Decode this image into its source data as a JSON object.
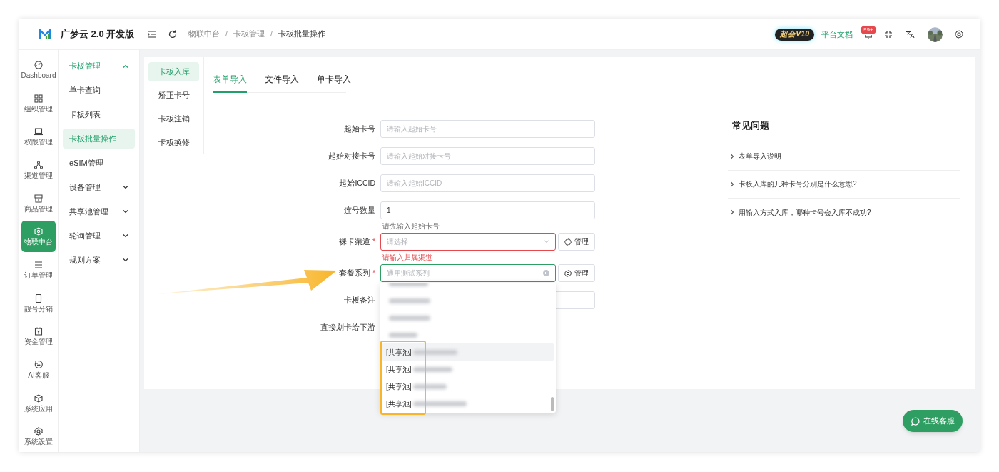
{
  "app": {
    "title": "广梦云 2.0 开发版"
  },
  "breadcrumb": [
    "物联中台",
    "卡板管理",
    "卡板批量操作"
  ],
  "breadcrumb_separator": "/",
  "header": {
    "badge": "超会V10",
    "docs_link": "平台文档",
    "notifications": "99+"
  },
  "rail": [
    {
      "label": "Dashboard",
      "selected": false
    },
    {
      "label": "组织管理",
      "selected": false
    },
    {
      "label": "权限管理",
      "selected": false
    },
    {
      "label": "渠道管理",
      "selected": false
    },
    {
      "label": "商品管理",
      "selected": false
    },
    {
      "label": "物联中台",
      "selected": true
    },
    {
      "label": "订单管理",
      "selected": false
    },
    {
      "label": "靓号分销",
      "selected": false
    },
    {
      "label": "资金管理",
      "selected": false
    },
    {
      "label": "AI客服",
      "selected": false
    },
    {
      "label": "系统应用",
      "selected": false
    },
    {
      "label": "系统设置",
      "selected": false
    }
  ],
  "sidebar": {
    "items": [
      {
        "label": "卡板管理",
        "expanded": true,
        "children": [
          {
            "label": "单卡查询",
            "selected": false
          },
          {
            "label": "卡板列表",
            "selected": false
          },
          {
            "label": "卡板批量操作",
            "selected": true
          }
        ]
      },
      {
        "label": "eSIM管理"
      },
      {
        "label": "设备管理",
        "expanded": false
      },
      {
        "label": "共享池管理",
        "expanded": false
      },
      {
        "label": "轮询管理",
        "expanded": false
      },
      {
        "label": "规则方案",
        "expanded": false
      }
    ]
  },
  "sub_tabs": [
    {
      "label": "卡板入库",
      "selected": true
    },
    {
      "label": "矫正卡号",
      "selected": false
    },
    {
      "label": "卡板注销",
      "selected": false
    },
    {
      "label": "卡板换修",
      "selected": false
    }
  ],
  "tabs": [
    {
      "label": "表单导入",
      "selected": true
    },
    {
      "label": "文件导入",
      "selected": false
    },
    {
      "label": "单卡导入",
      "selected": false
    }
  ],
  "form": {
    "required_mark": "*",
    "fields": [
      {
        "label": "起始卡号",
        "required": false,
        "kind": "input",
        "placeholder": "请输入起始卡号"
      },
      {
        "label": "起始对接卡号",
        "required": false,
        "kind": "input",
        "placeholder": "请输入起始对接卡号"
      },
      {
        "label": "起始ICCID",
        "required": false,
        "kind": "input",
        "placeholder": "请输入起始ICCID"
      },
      {
        "label": "连号数量",
        "required": false,
        "kind": "input",
        "value": "1",
        "hint": "请先输入起始卡号"
      },
      {
        "label": "裸卡渠道",
        "required": true,
        "kind": "select",
        "placeholder": "请选择",
        "error": "请输入归属渠道",
        "focused": false,
        "manage": "管理"
      },
      {
        "label": "套餐系列",
        "required": true,
        "kind": "select",
        "placeholder": "通用测试系列",
        "focused": true,
        "manage": "管理"
      },
      {
        "label": "卡板备注",
        "required": false,
        "kind": "input"
      },
      {
        "label": "直接划卡给下游",
        "required": false,
        "kind": "covered"
      }
    ]
  },
  "dropdown": {
    "items": [
      {
        "kind": "blurred",
        "selected": false
      },
      {
        "kind": "blurred",
        "selected": false
      },
      {
        "kind": "blurred",
        "selected": false
      },
      {
        "kind": "blurred",
        "selected": false
      },
      {
        "kind": "tagged",
        "tag": "[共享池]",
        "selected": true
      },
      {
        "kind": "tagged",
        "tag": "[共享池]",
        "selected": false
      },
      {
        "kind": "tagged",
        "tag": "[共享池]",
        "selected": false
      },
      {
        "kind": "tagged",
        "tag": "[共享池]",
        "selected": false
      }
    ]
  },
  "faq": {
    "title": "常见问题",
    "items": [
      "表单导入说明",
      "卡板入库的几种卡号分别是什么意思?",
      "用输入方式入库，哪种卡号会入库不成功?"
    ]
  },
  "chat_button": "在线客服"
}
